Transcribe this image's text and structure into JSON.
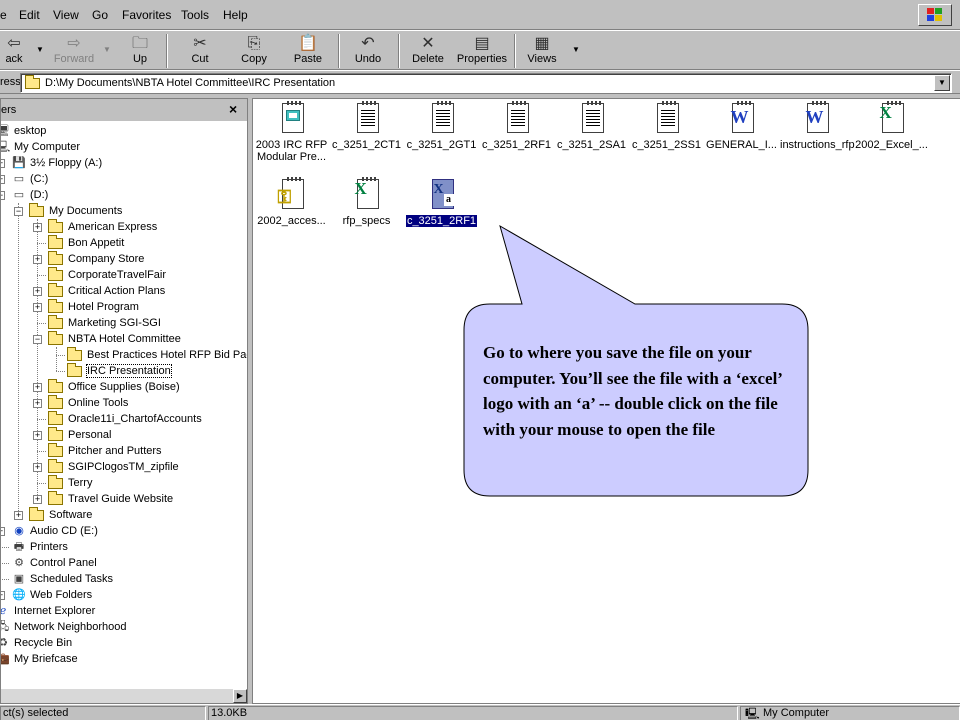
{
  "menu": {
    "items": [
      {
        "label": "e"
      },
      {
        "label": "Edit"
      },
      {
        "label": "View"
      },
      {
        "label": "Go"
      },
      {
        "label": "Favorites"
      },
      {
        "label": "Tools"
      },
      {
        "label": "Help"
      }
    ]
  },
  "toolbar": {
    "back_label": "ack",
    "forward_label": "Forward",
    "up_label": "Up",
    "cut_label": "Cut",
    "copy_label": "Copy",
    "paste_label": "Paste",
    "undo_label": "Undo",
    "delete_label": "Delete",
    "properties_label": "Properties",
    "views_label": "Views"
  },
  "address": {
    "label": "ress",
    "value": "D:\\My Documents\\NBTA Hotel Committee\\IRC Presentation"
  },
  "left_pane": {
    "title": "ers",
    "close": "×",
    "tree": [
      {
        "label": "esktop"
      },
      {
        "label": "My Computer"
      },
      {
        "label": "3½ Floppy (A:)"
      },
      {
        "label": "(C:)"
      },
      {
        "label": "(D:)"
      },
      {
        "label": "My Documents"
      },
      {
        "label": "American Express"
      },
      {
        "label": "Bon Appetit"
      },
      {
        "label": "Company Store"
      },
      {
        "label": "CorporateTravelFair"
      },
      {
        "label": "Critical Action Plans"
      },
      {
        "label": "Hotel Program"
      },
      {
        "label": "Marketing SGI-SGI"
      },
      {
        "label": "NBTA Hotel Committee"
      },
      {
        "label": "Best Practices Hotel RFP Bid Pac"
      },
      {
        "label": "IRC Presentation"
      },
      {
        "label": "Office Supplies (Boise)"
      },
      {
        "label": "Online Tools"
      },
      {
        "label": "Oracle11i_ChartofAccounts"
      },
      {
        "label": "Personal"
      },
      {
        "label": "Pitcher and Putters"
      },
      {
        "label": "SGIPClogosTM_zipfile"
      },
      {
        "label": "Terry"
      },
      {
        "label": "Travel Guide Website"
      },
      {
        "label": "Software"
      },
      {
        "label": "Audio CD (E:)"
      },
      {
        "label": "Printers"
      },
      {
        "label": "Control Panel"
      },
      {
        "label": "Scheduled Tasks"
      },
      {
        "label": "Web Folders"
      },
      {
        "label": "Internet Explorer"
      },
      {
        "label": "Network Neighborhood"
      },
      {
        "label": "Recycle Bin"
      },
      {
        "label": "My Briefcase"
      }
    ]
  },
  "files": [
    {
      "name": "2003 IRC RFP Modular Pre...",
      "icon": "powerpoint-doc-icon"
    },
    {
      "name": "c_3251_2CT1",
      "icon": "text-doc-icon"
    },
    {
      "name": "c_3251_2GT1",
      "icon": "text-doc-icon"
    },
    {
      "name": "c_3251_2RF1",
      "icon": "text-doc-icon"
    },
    {
      "name": "c_3251_2SA1",
      "icon": "text-doc-icon"
    },
    {
      "name": "c_3251_2SS1",
      "icon": "text-doc-icon"
    },
    {
      "name": "GENERAL_I...",
      "icon": "word-doc-icon"
    },
    {
      "name": "instructions_rfp",
      "icon": "word-doc-icon"
    },
    {
      "name": "2002_Excel_...",
      "icon": "excel-doc-icon"
    },
    {
      "name": "2002_acces...",
      "icon": "access-doc-icon"
    },
    {
      "name": "rfp_specs",
      "icon": "excel-doc-icon"
    },
    {
      "name": "c_3251_2RF1",
      "icon": "excel-addin-icon"
    }
  ],
  "callout": {
    "text": "Go to where you save the file on your computer. You’ll see the file with a ‘excel’ logo with an ‘a’ -- double click on the file with your mouse to open the file"
  },
  "status": {
    "selection": "ct(s) selected",
    "size": "13.0KB",
    "zone": "My Computer"
  },
  "colors": {
    "selection": "#000080",
    "callout_fill": "#ccccff",
    "excel_green": "#008040",
    "word_blue": "#2040c0"
  }
}
